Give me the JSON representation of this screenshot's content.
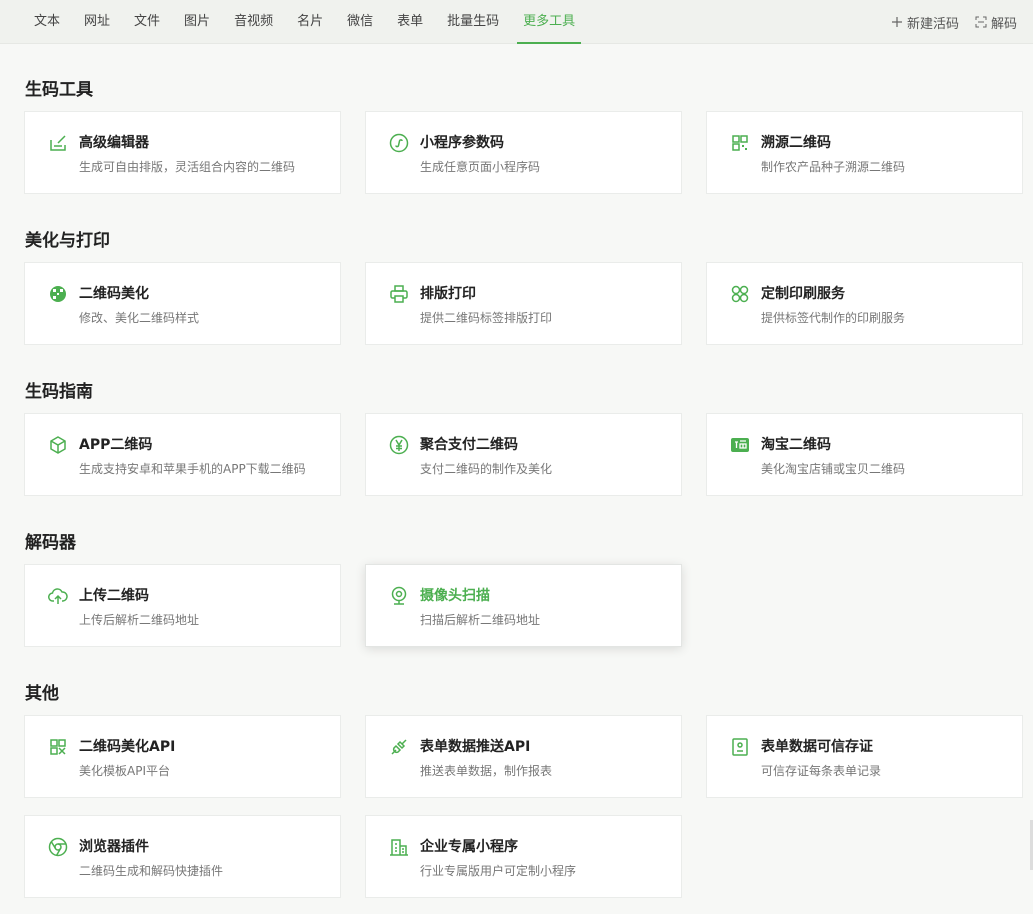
{
  "nav": {
    "tabs": [
      "文本",
      "网址",
      "文件",
      "图片",
      "音视频",
      "名片",
      "微信",
      "表单",
      "批量生码",
      "更多工具"
    ],
    "active_tab": "更多工具",
    "new_live_code": "新建活码",
    "decode": "解码"
  },
  "colors": {
    "accent": "#4caf50",
    "background": "#f7f8f6",
    "card": "#ffffff"
  },
  "sections": [
    {
      "title": "生码工具",
      "cards": [
        {
          "title": "高级编辑器",
          "desc": "生成可自由排版，灵活组合内容的二维码",
          "icon": "edit-icon"
        },
        {
          "title": "小程序参数码",
          "desc": "生成任意页面小程序码",
          "icon": "mini-program-icon"
        },
        {
          "title": "溯源二维码",
          "desc": "制作农产品种子溯源二维码",
          "icon": "qr-grid-icon"
        }
      ]
    },
    {
      "title": "美化与打印",
      "cards": [
        {
          "title": "二维码美化",
          "desc": "修改、美化二维码样式",
          "icon": "palette-icon"
        },
        {
          "title": "排版打印",
          "desc": "提供二维码标签排版打印",
          "icon": "printer-icon"
        },
        {
          "title": "定制印刷服务",
          "desc": "提供标签代制作的印刷服务",
          "icon": "command-icon"
        }
      ]
    },
    {
      "title": "生码指南",
      "cards": [
        {
          "title": "APP二维码",
          "desc": "生成支持安卓和苹果手机的APP下载二维码",
          "icon": "cube-icon"
        },
        {
          "title": "聚合支付二维码",
          "desc": "支付二维码的制作及美化",
          "icon": "yen-icon"
        },
        {
          "title": "淘宝二维码",
          "desc": "美化淘宝店铺或宝贝二维码",
          "icon": "taobao-icon"
        }
      ]
    },
    {
      "title": "解码器",
      "cards": [
        {
          "title": "上传二维码",
          "desc": "上传后解析二维码地址",
          "icon": "cloud-upload-icon"
        },
        {
          "title": "摄像头扫描",
          "desc": "扫描后解析二维码地址",
          "icon": "camera-icon"
        }
      ]
    },
    {
      "title": "其他",
      "cards": [
        {
          "title": "二维码美化API",
          "desc": "美化模板API平台",
          "icon": "qr-api-icon"
        },
        {
          "title": "表单数据推送API",
          "desc": "推送表单数据，制作报表",
          "icon": "plug-icon"
        },
        {
          "title": "表单数据可信存证",
          "desc": "可信存证每条表单记录",
          "icon": "certificate-icon"
        },
        {
          "title": "浏览器插件",
          "desc": "二维码生成和解码快捷插件",
          "icon": "browser-icon"
        },
        {
          "title": "企业专属小程序",
          "desc": "行业专属版用户可定制小程序",
          "icon": "building-icon"
        }
      ]
    }
  ]
}
